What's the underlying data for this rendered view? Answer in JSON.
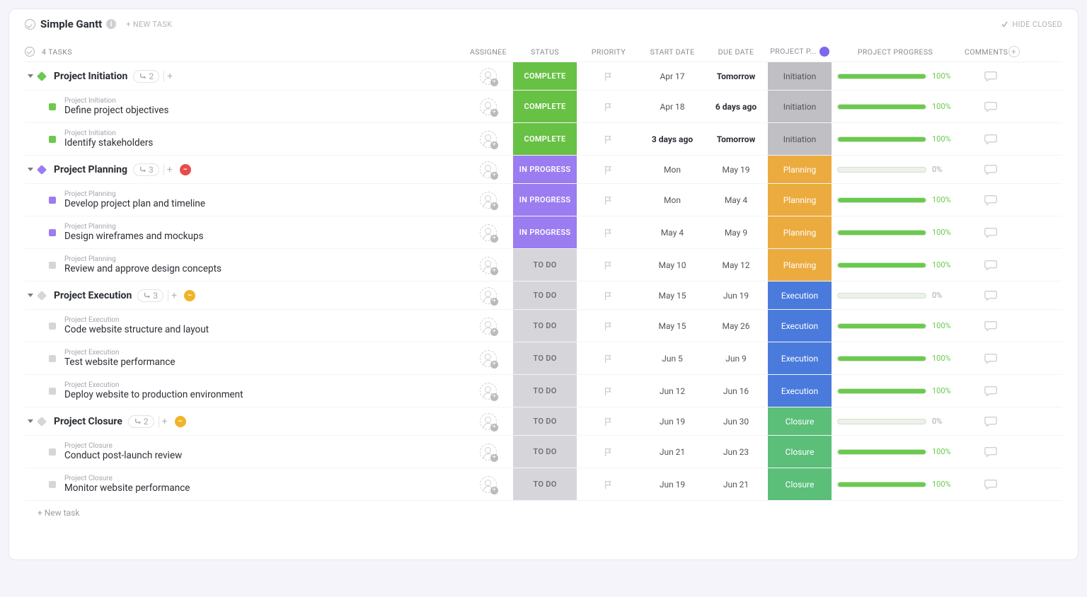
{
  "header": {
    "title": "Simple Gantt",
    "new_task": "+ NEW TASK",
    "hide_closed": "HIDE CLOSED",
    "task_count": "4 TASKS"
  },
  "columns": {
    "assignee": "ASSIGNEE",
    "status": "STATUS",
    "priority": "PRIORITY",
    "start_date": "START DATE",
    "due_date": "DUE DATE",
    "phase": "PROJECT P...",
    "progress": "PROJECT PROGRESS",
    "comments": "COMMENTS"
  },
  "statuses": {
    "complete": "COMPLETE",
    "in_progress": "IN PROGRESS",
    "to_do": "TO DO"
  },
  "phases": {
    "initiation": "Initiation",
    "planning": "Planning",
    "execution": "Execution",
    "closure": "Closure"
  },
  "groups": [
    {
      "name": "Project Initiation",
      "count": "2",
      "color": "green",
      "badge": null,
      "status": "complete",
      "start": "Apr 17",
      "due": "Tomorrow",
      "due_bold": true,
      "phase": "init",
      "progress": 100,
      "tasks": [
        {
          "parent": "Project Initiation",
          "title": "Define project objectives",
          "color": "green",
          "status": "complete",
          "start": "Apr 18",
          "due": "6 days ago",
          "due_bold": true,
          "phase": "init",
          "progress": 100
        },
        {
          "parent": "Project Initiation",
          "title": "Identify stakeholders",
          "color": "green",
          "status": "complete",
          "start": "3 days ago",
          "start_bold": true,
          "due": "Tomorrow",
          "due_bold": true,
          "phase": "init",
          "progress": 100
        }
      ]
    },
    {
      "name": "Project Planning",
      "count": "3",
      "color": "purple",
      "badge": "red",
      "status": "in_progress",
      "start": "Mon",
      "due": "May 19",
      "phase": "plan",
      "progress": 0,
      "tasks": [
        {
          "parent": "Project Planning",
          "title": "Develop project plan and timeline",
          "color": "purple",
          "status": "in_progress",
          "start": "Mon",
          "due": "May 4",
          "phase": "plan",
          "progress": 100
        },
        {
          "parent": "Project Planning",
          "title": "Design wireframes and mockups",
          "color": "purple",
          "status": "in_progress",
          "start": "May 4",
          "due": "May 9",
          "phase": "plan",
          "progress": 100
        },
        {
          "parent": "Project Planning",
          "title": "Review and approve design concepts",
          "color": "grey",
          "status": "to_do",
          "start": "May 10",
          "due": "May 12",
          "phase": "plan",
          "progress": 100
        }
      ]
    },
    {
      "name": "Project Execution",
      "count": "3",
      "color": "grey",
      "badge": "yellow",
      "status": "to_do",
      "start": "May 15",
      "due": "Jun 19",
      "phase": "exec",
      "progress": 0,
      "tasks": [
        {
          "parent": "Project Execution",
          "title": "Code website structure and layout",
          "color": "grey",
          "status": "to_do",
          "start": "May 15",
          "due": "May 26",
          "phase": "exec",
          "progress": 100
        },
        {
          "parent": "Project Execution",
          "title": "Test website performance",
          "color": "grey",
          "status": "to_do",
          "start": "Jun 5",
          "due": "Jun 9",
          "phase": "exec",
          "progress": 100
        },
        {
          "parent": "Project Execution",
          "title": "Deploy website to production environment",
          "color": "grey",
          "status": "to_do",
          "start": "Jun 12",
          "due": "Jun 16",
          "phase": "exec",
          "progress": 100
        }
      ]
    },
    {
      "name": "Project Closure",
      "count": "2",
      "color": "grey",
      "badge": "yellow",
      "status": "to_do",
      "start": "Jun 19",
      "due": "Jun 30",
      "phase": "close",
      "progress": 0,
      "tasks": [
        {
          "parent": "Project Closure",
          "title": "Conduct post-launch review",
          "color": "grey",
          "status": "to_do",
          "start": "Jun 21",
          "due": "Jun 23",
          "phase": "close",
          "progress": 100
        },
        {
          "parent": "Project Closure",
          "title": "Monitor website performance",
          "color": "grey",
          "status": "to_do",
          "start": "Jun 19",
          "due": "Jun 21",
          "phase": "close",
          "progress": 100
        }
      ]
    }
  ],
  "footer": {
    "new_task": "+ New task"
  }
}
